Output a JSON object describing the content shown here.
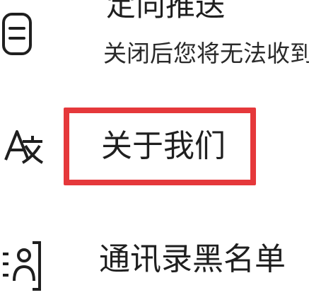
{
  "items": [
    {
      "title": "定向推送",
      "subtitle": "关闭后您将无法收到",
      "icon": "hamburger-menu-icon"
    },
    {
      "title": "关于我们",
      "icon": "translate-language-icon"
    },
    {
      "title": "通讯录黑名单",
      "icon": "contact-book-icon"
    }
  ],
  "colors": {
    "highlight": "#e5383b",
    "text": "#1f1f1f"
  }
}
